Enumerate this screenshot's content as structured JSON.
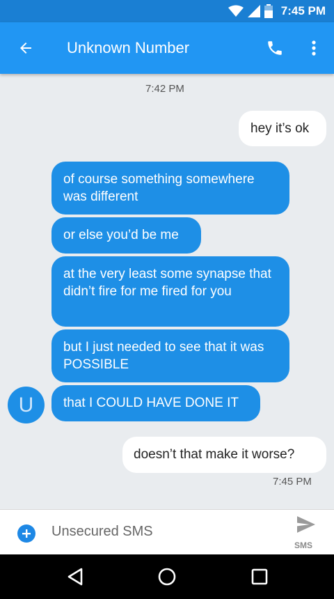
{
  "status_bar": {
    "time": "7:45 PM"
  },
  "header": {
    "title": "Unknown Number"
  },
  "conversation": {
    "timestamp_top": "7:42 PM",
    "messages": [
      {
        "direction": "outgoing",
        "text": "hey it’s ok"
      },
      {
        "direction": "incoming",
        "text": "of course something somewhere was different"
      },
      {
        "direction": "incoming",
        "text": "or else you’d be me"
      },
      {
        "direction": "incoming",
        "text": "at the very least some synapse that didn’t fire for me fired for you"
      },
      {
        "direction": "incoming",
        "text": "but I just needed to see that it was POSSIBLE"
      },
      {
        "direction": "incoming",
        "text": "that I COULD HAVE DONE IT"
      },
      {
        "direction": "outgoing",
        "text": "doesn’t that make it worse?"
      }
    ],
    "timestamp_bottom": "7:45 PM",
    "avatar_letter": "U"
  },
  "compose": {
    "placeholder": "Unsecured SMS",
    "send_label": "SMS"
  },
  "colors": {
    "primary": "#2196f3",
    "status_bar": "#1a7fd3",
    "incoming_bubble": "#1e8fe6",
    "outgoing_bubble": "#ffffff",
    "background": "#e9ecef"
  }
}
